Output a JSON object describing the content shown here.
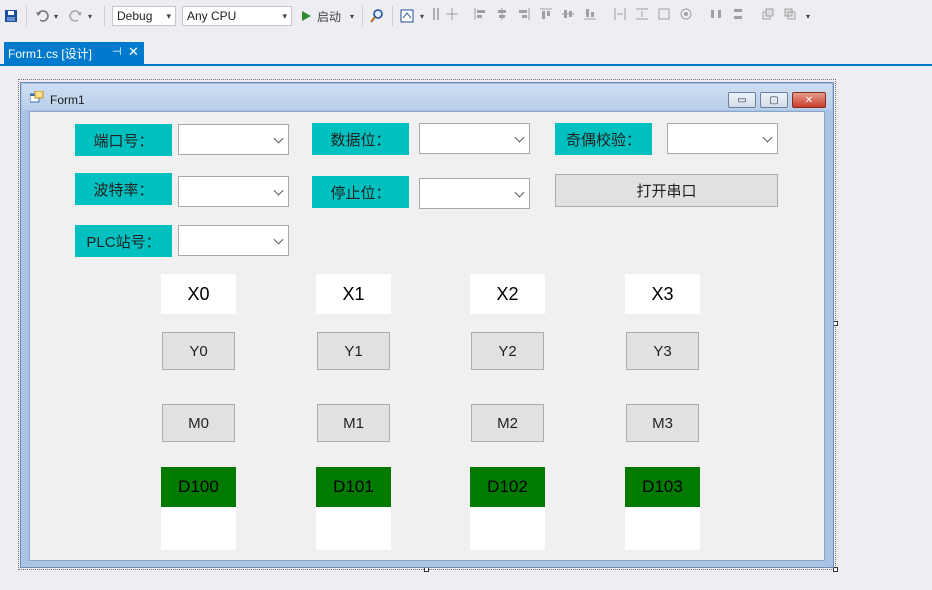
{
  "toolbar": {
    "config": "Debug",
    "platform": "Any CPU",
    "start_label": "启动"
  },
  "document_tab": {
    "title": "Form1.cs [设计]",
    "pin_glyph": "⊣",
    "close_glyph": "✕"
  },
  "form": {
    "title": "Form1",
    "labels": {
      "port": "端口号：",
      "data_bits": "数据位：",
      "parity": "奇偶校验：",
      "baud": "波特率：",
      "stop_bits": "停止位：",
      "plc_station": "PLC站号："
    },
    "open_port_button": "打开串口",
    "x_labels": [
      "X0",
      "X1",
      "X2",
      "X3"
    ],
    "y_buttons": [
      "Y0",
      "Y1",
      "Y2",
      "Y3"
    ],
    "m_buttons": [
      "M0",
      "M1",
      "M2",
      "M3"
    ],
    "d_labels": [
      "D100",
      "D101",
      "D102",
      "D103"
    ]
  },
  "colors": {
    "accent": "#007acc",
    "label_cyan": "#00c0c0",
    "d_green": "#007a00"
  }
}
